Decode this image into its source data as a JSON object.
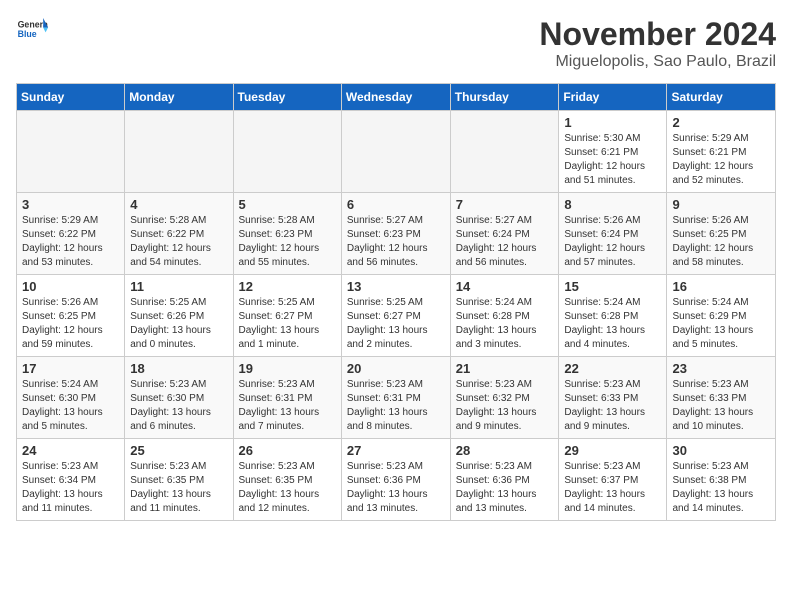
{
  "header": {
    "logo_general": "General",
    "logo_blue": "Blue",
    "month_title": "November 2024",
    "location": "Miguelopolis, Sao Paulo, Brazil"
  },
  "weekdays": [
    "Sunday",
    "Monday",
    "Tuesday",
    "Wednesday",
    "Thursday",
    "Friday",
    "Saturday"
  ],
  "weeks": [
    [
      {
        "day": "",
        "info": ""
      },
      {
        "day": "",
        "info": ""
      },
      {
        "day": "",
        "info": ""
      },
      {
        "day": "",
        "info": ""
      },
      {
        "day": "",
        "info": ""
      },
      {
        "day": "1",
        "info": "Sunrise: 5:30 AM\nSunset: 6:21 PM\nDaylight: 12 hours and 51 minutes."
      },
      {
        "day": "2",
        "info": "Sunrise: 5:29 AM\nSunset: 6:21 PM\nDaylight: 12 hours and 52 minutes."
      }
    ],
    [
      {
        "day": "3",
        "info": "Sunrise: 5:29 AM\nSunset: 6:22 PM\nDaylight: 12 hours and 53 minutes."
      },
      {
        "day": "4",
        "info": "Sunrise: 5:28 AM\nSunset: 6:22 PM\nDaylight: 12 hours and 54 minutes."
      },
      {
        "day": "5",
        "info": "Sunrise: 5:28 AM\nSunset: 6:23 PM\nDaylight: 12 hours and 55 minutes."
      },
      {
        "day": "6",
        "info": "Sunrise: 5:27 AM\nSunset: 6:23 PM\nDaylight: 12 hours and 56 minutes."
      },
      {
        "day": "7",
        "info": "Sunrise: 5:27 AM\nSunset: 6:24 PM\nDaylight: 12 hours and 56 minutes."
      },
      {
        "day": "8",
        "info": "Sunrise: 5:26 AM\nSunset: 6:24 PM\nDaylight: 12 hours and 57 minutes."
      },
      {
        "day": "9",
        "info": "Sunrise: 5:26 AM\nSunset: 6:25 PM\nDaylight: 12 hours and 58 minutes."
      }
    ],
    [
      {
        "day": "10",
        "info": "Sunrise: 5:26 AM\nSunset: 6:25 PM\nDaylight: 12 hours and 59 minutes."
      },
      {
        "day": "11",
        "info": "Sunrise: 5:25 AM\nSunset: 6:26 PM\nDaylight: 13 hours and 0 minutes."
      },
      {
        "day": "12",
        "info": "Sunrise: 5:25 AM\nSunset: 6:27 PM\nDaylight: 13 hours and 1 minute."
      },
      {
        "day": "13",
        "info": "Sunrise: 5:25 AM\nSunset: 6:27 PM\nDaylight: 13 hours and 2 minutes."
      },
      {
        "day": "14",
        "info": "Sunrise: 5:24 AM\nSunset: 6:28 PM\nDaylight: 13 hours and 3 minutes."
      },
      {
        "day": "15",
        "info": "Sunrise: 5:24 AM\nSunset: 6:28 PM\nDaylight: 13 hours and 4 minutes."
      },
      {
        "day": "16",
        "info": "Sunrise: 5:24 AM\nSunset: 6:29 PM\nDaylight: 13 hours and 5 minutes."
      }
    ],
    [
      {
        "day": "17",
        "info": "Sunrise: 5:24 AM\nSunset: 6:30 PM\nDaylight: 13 hours and 5 minutes."
      },
      {
        "day": "18",
        "info": "Sunrise: 5:23 AM\nSunset: 6:30 PM\nDaylight: 13 hours and 6 minutes."
      },
      {
        "day": "19",
        "info": "Sunrise: 5:23 AM\nSunset: 6:31 PM\nDaylight: 13 hours and 7 minutes."
      },
      {
        "day": "20",
        "info": "Sunrise: 5:23 AM\nSunset: 6:31 PM\nDaylight: 13 hours and 8 minutes."
      },
      {
        "day": "21",
        "info": "Sunrise: 5:23 AM\nSunset: 6:32 PM\nDaylight: 13 hours and 9 minutes."
      },
      {
        "day": "22",
        "info": "Sunrise: 5:23 AM\nSunset: 6:33 PM\nDaylight: 13 hours and 9 minutes."
      },
      {
        "day": "23",
        "info": "Sunrise: 5:23 AM\nSunset: 6:33 PM\nDaylight: 13 hours and 10 minutes."
      }
    ],
    [
      {
        "day": "24",
        "info": "Sunrise: 5:23 AM\nSunset: 6:34 PM\nDaylight: 13 hours and 11 minutes."
      },
      {
        "day": "25",
        "info": "Sunrise: 5:23 AM\nSunset: 6:35 PM\nDaylight: 13 hours and 11 minutes."
      },
      {
        "day": "26",
        "info": "Sunrise: 5:23 AM\nSunset: 6:35 PM\nDaylight: 13 hours and 12 minutes."
      },
      {
        "day": "27",
        "info": "Sunrise: 5:23 AM\nSunset: 6:36 PM\nDaylight: 13 hours and 13 minutes."
      },
      {
        "day": "28",
        "info": "Sunrise: 5:23 AM\nSunset: 6:36 PM\nDaylight: 13 hours and 13 minutes."
      },
      {
        "day": "29",
        "info": "Sunrise: 5:23 AM\nSunset: 6:37 PM\nDaylight: 13 hours and 14 minutes."
      },
      {
        "day": "30",
        "info": "Sunrise: 5:23 AM\nSunset: 6:38 PM\nDaylight: 13 hours and 14 minutes."
      }
    ]
  ]
}
